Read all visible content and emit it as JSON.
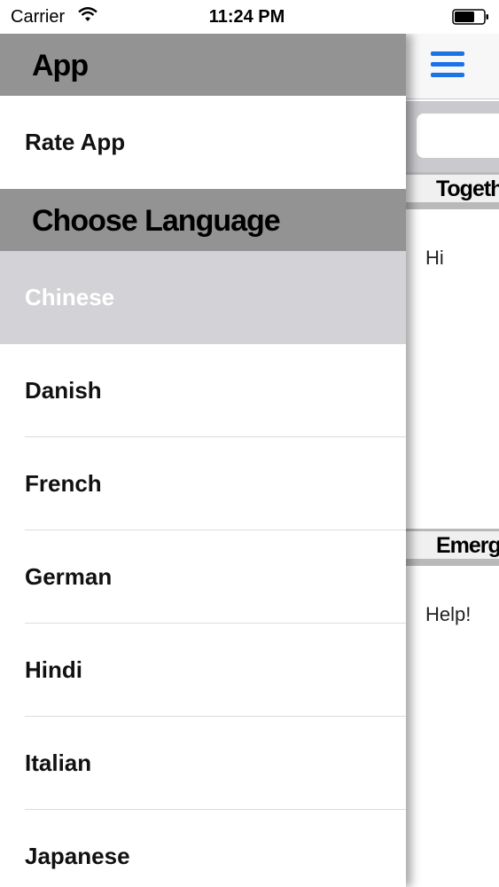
{
  "status_bar": {
    "carrier": "Carrier",
    "time": "11:24 PM",
    "wifi_icon": "wifi-icon",
    "battery_icon": "battery-icon"
  },
  "drawer": {
    "app_section": "App",
    "rate_app": "Rate App",
    "language_section": "Choose Language",
    "languages": [
      {
        "label": "Chinese",
        "selected": true
      },
      {
        "label": "Danish",
        "selected": false
      },
      {
        "label": "French",
        "selected": false
      },
      {
        "label": "German",
        "selected": false
      },
      {
        "label": "Hindi",
        "selected": false
      },
      {
        "label": "Italian",
        "selected": false
      },
      {
        "label": "Japanese",
        "selected": false
      }
    ]
  },
  "content": {
    "menu_icon": "hamburger-menu-icon",
    "together_header": "Together",
    "together_message": "Hi",
    "emergency_header": "Emergency",
    "emergency_message": "Help!"
  },
  "colors": {
    "accent": "#1a73e8",
    "section_header_bg": "#939393",
    "selected_row_bg": "#d3d2d6"
  }
}
